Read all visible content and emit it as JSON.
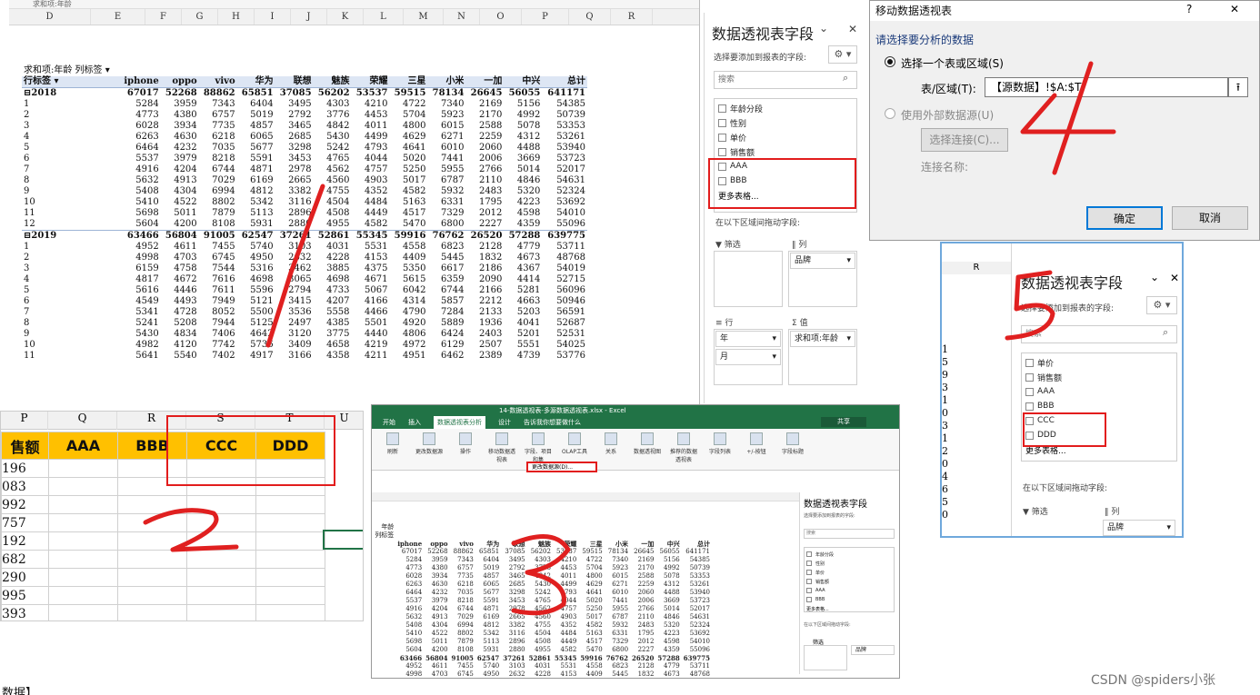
{
  "sheet1": {
    "title_fragment": "求和项:年龄",
    "col_letters": [
      "D",
      "E",
      "F",
      "G",
      "H",
      "I",
      "J",
      "K",
      "L",
      "M",
      "N",
      "O",
      "P",
      "Q",
      "R"
    ],
    "pivot_corner": "求和项:年龄",
    "pivot_col_label": "列标签",
    "row_label": "行标签",
    "brands": [
      "iphone",
      "oppo",
      "vivo",
      "华为",
      "联想",
      "魅族",
      "荣耀",
      "三星",
      "小米",
      "一加",
      "中兴",
      "总计"
    ],
    "year2018": "2018",
    "year2018_vals": [
      "67017",
      "52268",
      "88862",
      "65851",
      "37085",
      "56202",
      "53537",
      "59515",
      "78134",
      "26645",
      "56055",
      "641171"
    ],
    "rows2018": [
      {
        "m": "1",
        "v": [
          "5284",
          "3959",
          "7343",
          "6404",
          "3495",
          "4303",
          "4210",
          "4722",
          "7340",
          "2169",
          "5156",
          "54385"
        ]
      },
      {
        "m": "2",
        "v": [
          "4773",
          "4380",
          "6757",
          "5019",
          "2792",
          "3776",
          "4453",
          "5704",
          "5923",
          "2170",
          "4992",
          "50739"
        ]
      },
      {
        "m": "3",
        "v": [
          "6028",
          "3934",
          "7735",
          "4857",
          "3465",
          "4842",
          "4011",
          "4800",
          "6015",
          "2588",
          "5078",
          "53353"
        ]
      },
      {
        "m": "4",
        "v": [
          "6263",
          "4630",
          "6218",
          "6065",
          "2685",
          "5430",
          "4499",
          "4629",
          "6271",
          "2259",
          "4312",
          "53261"
        ]
      },
      {
        "m": "5",
        "v": [
          "6464",
          "4232",
          "7035",
          "5677",
          "3298",
          "5242",
          "4793",
          "4641",
          "6010",
          "2060",
          "4488",
          "53940"
        ]
      },
      {
        "m": "6",
        "v": [
          "5537",
          "3979",
          "8218",
          "5591",
          "3453",
          "4765",
          "4044",
          "5020",
          "7441",
          "2006",
          "3669",
          "53723"
        ]
      },
      {
        "m": "7",
        "v": [
          "4916",
          "4204",
          "6744",
          "4871",
          "2978",
          "4562",
          "4757",
          "5250",
          "5955",
          "2766",
          "5014",
          "52017"
        ]
      },
      {
        "m": "8",
        "v": [
          "5632",
          "4913",
          "7029",
          "6169",
          "2665",
          "4560",
          "4903",
          "5017",
          "6787",
          "2110",
          "4846",
          "54631"
        ]
      },
      {
        "m": "9",
        "v": [
          "5408",
          "4304",
          "6994",
          "4812",
          "3382",
          "4755",
          "4352",
          "4582",
          "5932",
          "2483",
          "5320",
          "52324"
        ]
      },
      {
        "m": "10",
        "v": [
          "5410",
          "4522",
          "8802",
          "5342",
          "3116",
          "4504",
          "4484",
          "5163",
          "6331",
          "1795",
          "4223",
          "53692"
        ]
      },
      {
        "m": "11",
        "v": [
          "5698",
          "5011",
          "7879",
          "5113",
          "2896",
          "4508",
          "4449",
          "4517",
          "7329",
          "2012",
          "4598",
          "54010"
        ]
      },
      {
        "m": "12",
        "v": [
          "5604",
          "4200",
          "8108",
          "5931",
          "2880",
          "4955",
          "4582",
          "5470",
          "6800",
          "2227",
          "4359",
          "55096"
        ]
      }
    ],
    "year2019": "2019",
    "year2019_vals": [
      "63466",
      "56804",
      "91005",
      "62547",
      "37261",
      "52861",
      "55345",
      "59916",
      "76762",
      "26520",
      "57288",
      "639775"
    ],
    "rows2019": [
      {
        "m": "1",
        "v": [
          "4952",
          "4611",
          "7455",
          "5740",
          "3103",
          "4031",
          "5531",
          "4558",
          "6823",
          "2128",
          "4779",
          "53711"
        ]
      },
      {
        "m": "2",
        "v": [
          "4998",
          "4703",
          "6745",
          "4950",
          "2632",
          "4228",
          "4153",
          "4409",
          "5445",
          "1832",
          "4673",
          "48768"
        ]
      },
      {
        "m": "3",
        "v": [
          "6159",
          "4758",
          "7544",
          "5316",
          "3462",
          "3885",
          "4375",
          "5350",
          "6617",
          "2186",
          "4367",
          "54019"
        ]
      },
      {
        "m": "4",
        "v": [
          "4817",
          "4672",
          "7616",
          "4698",
          "3065",
          "4698",
          "4671",
          "5615",
          "6359",
          "2090",
          "4414",
          "52715"
        ]
      },
      {
        "m": "5",
        "v": [
          "5616",
          "4446",
          "7611",
          "5596",
          "2794",
          "4733",
          "5067",
          "6042",
          "6744",
          "2166",
          "5281",
          "56096"
        ]
      },
      {
        "m": "6",
        "v": [
          "4549",
          "4493",
          "7949",
          "5121",
          "3415",
          "4207",
          "4166",
          "4314",
          "5857",
          "2212",
          "4663",
          "50946"
        ]
      },
      {
        "m": "7",
        "v": [
          "5341",
          "4728",
          "8052",
          "5500",
          "3536",
          "5558",
          "4466",
          "4790",
          "7284",
          "2133",
          "5203",
          "56591"
        ]
      },
      {
        "m": "8",
        "v": [
          "5241",
          "5208",
          "7944",
          "5125",
          "2497",
          "4385",
          "5501",
          "4920",
          "5889",
          "1936",
          "4041",
          "52687"
        ]
      },
      {
        "m": "9",
        "v": [
          "5430",
          "4834",
          "7406",
          "4642",
          "3120",
          "3775",
          "4440",
          "4806",
          "6424",
          "2403",
          "5201",
          "52531"
        ]
      },
      {
        "m": "10",
        "v": [
          "4982",
          "4120",
          "7742",
          "5736",
          "3409",
          "4658",
          "4219",
          "4972",
          "6129",
          "2507",
          "5551",
          "54025"
        ]
      },
      {
        "m": "11",
        "v": [
          "5641",
          "5540",
          "7402",
          "4917",
          "3166",
          "4358",
          "4211",
          "4951",
          "6462",
          "2389",
          "4739",
          "53776"
        ]
      }
    ]
  },
  "field_panel1": {
    "title": "数据透视表字段",
    "choose_label": "选择要添加到报表的字段:",
    "search_placeholder": "搜索",
    "fields": [
      "年龄分段",
      "性别",
      "单价",
      "销售额",
      "AAA",
      "BBB"
    ],
    "more_tables": "更多表格...",
    "drag_label": "在以下区域间拖动字段:",
    "filter_label": "筛选",
    "column_label": "列",
    "column_value": "品牌",
    "row_label": "行",
    "value_label": "值",
    "row_values": [
      "年",
      "月"
    ],
    "value_value": "求和项:年龄"
  },
  "move_dialog": {
    "title": "移动数据透视表",
    "help": "?",
    "close": "✕",
    "prompt": "请选择要分析的数据",
    "opt1": "选择一个表或区域(S)",
    "table_label": "表/区域(T):",
    "table_value": "【源数据】!$A:$T",
    "opt2": "使用外部数据源(U)",
    "choose_conn": "选择连接(C)...",
    "conn_name": "连接名称:",
    "ok": "确定",
    "cancel": "取消"
  },
  "field_panel2": {
    "title": "数据透视表字段",
    "choose_label": "选择要添加到报表的字段:",
    "search_placeholder": "搜索",
    "col_r": "R",
    "fields": [
      "单价",
      "销售额",
      "AAA",
      "BBB",
      "CCC",
      "DDD"
    ],
    "more_tables": "更多表格...",
    "drag_label": "在以下区域间拖动字段:",
    "filter_label": "筛选",
    "column_label": "列",
    "column_value": "品牌",
    "row_nums": [
      "1",
      "5",
      "9",
      "3",
      "1",
      "0",
      "3",
      "1",
      "2",
      "0",
      "4",
      "6",
      "5",
      "0"
    ]
  },
  "sheet2": {
    "col_letters": [
      "P",
      "Q",
      "R",
      "S",
      "T",
      "U"
    ],
    "headers": [
      "售额",
      "AAA",
      "BBB",
      "CCC",
      "DDD"
    ],
    "values": [
      "196",
      "083",
      "992",
      "757",
      "192",
      "682",
      "290",
      "995",
      "393"
    ]
  },
  "excel3": {
    "title": "14-数据透视表-多源数据透视表.xlsx - Excel",
    "tabs": [
      "开始",
      "插入",
      "数据透视表分析",
      "设计",
      "告诉我你想要做什么"
    ],
    "ribbon": [
      "刷新",
      "更改数据源",
      "操作",
      "移动数据透视表",
      "字段、项目和集",
      "OLAP工具",
      "关系",
      "数据透视图",
      "推荐的数据透视表",
      "字段列表",
      "+/-按钮",
      "字段标题"
    ],
    "menu_item": "更改数据源(D)...",
    "share": "共享",
    "pivot_corner": "年龄",
    "col_label": "列标签",
    "brands": [
      "iphone",
      "oppo",
      "vivo",
      "华为",
      "联想",
      "魅族",
      "荣耀",
      "三星",
      "小米",
      "一加",
      "中兴",
      "总计"
    ],
    "panel_title": "数据透视表字段",
    "panel_choose": "选择要添加到报表的字段:",
    "panel_search": "搜索",
    "panel_fields": [
      "年龄分段",
      "性别",
      "单价",
      "销售额",
      "AAA",
      "BBB"
    ],
    "panel_more": "更多表格...",
    "panel_drag": "在以下区域间拖动字段:",
    "panel_filter": "筛选",
    "panel_col": "品牌"
  },
  "annotations": [
    "1",
    "2",
    "3",
    "4",
    "5"
  ],
  "status_tab": "数据】",
  "watermark": "CSDN @spiders小张"
}
